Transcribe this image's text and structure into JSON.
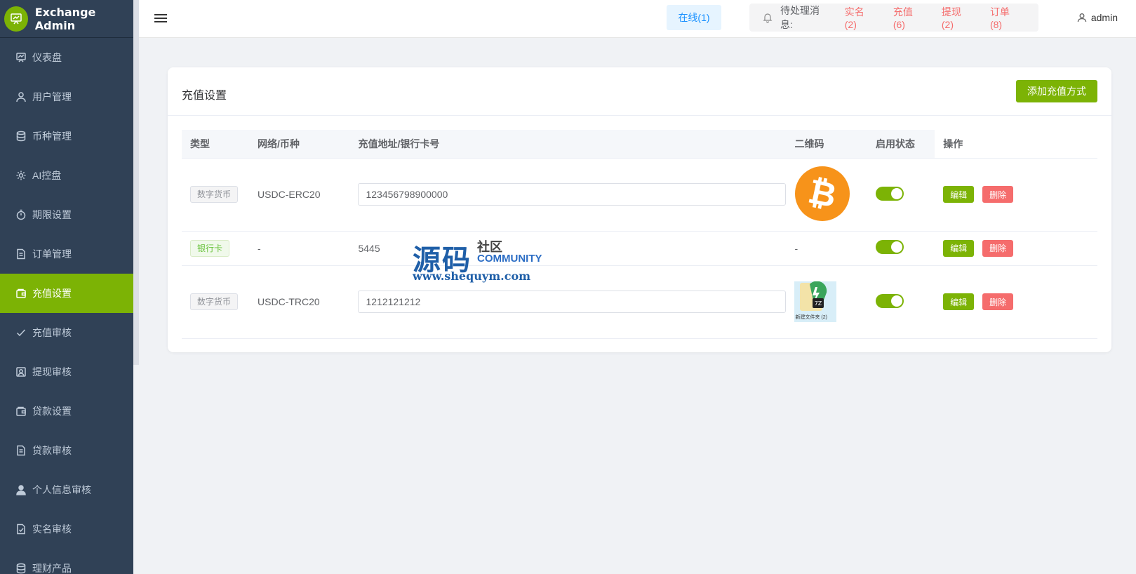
{
  "app": {
    "title": "Exchange Admin"
  },
  "sidebar": {
    "items": [
      {
        "label": "仪表盘",
        "icon": "dashboard-icon"
      },
      {
        "label": "用户管理",
        "icon": "user-icon"
      },
      {
        "label": "币种管理",
        "icon": "database-icon"
      },
      {
        "label": "AI控盘",
        "icon": "gear-icon"
      },
      {
        "label": "期限设置",
        "icon": "stopwatch-icon"
      },
      {
        "label": "订单管理",
        "icon": "document-icon"
      },
      {
        "label": "充值设置",
        "icon": "wallet-icon",
        "active": true
      },
      {
        "label": "充值审核",
        "icon": "check-icon"
      },
      {
        "label": "提现审核",
        "icon": "image-icon"
      },
      {
        "label": "贷款设置",
        "icon": "wallet-icon"
      },
      {
        "label": "贷款审核",
        "icon": "document-icon"
      },
      {
        "label": "个人信息审核",
        "icon": "person-filled-icon"
      },
      {
        "label": "实名审核",
        "icon": "doc-check-icon"
      },
      {
        "label": "理财产品",
        "icon": "database-icon"
      }
    ]
  },
  "header": {
    "online": "在线(1)",
    "pending_label": "待处理消息:",
    "pending_links": [
      "实名(2)",
      "充值(6)",
      "提现(2)",
      "订单(8)"
    ],
    "user": "admin"
  },
  "card": {
    "title": "充值设置",
    "add_button": "添加充值方式"
  },
  "table": {
    "headers": [
      "类型",
      "网络/币种",
      "充值地址/银行卡号",
      "二维码",
      "启用状态",
      "操作"
    ],
    "rows": [
      {
        "type": "数字货币",
        "type_style": "gray",
        "network": "USDC-ERC20",
        "address": "123456798900000",
        "address_input": true,
        "qr": "bitcoin",
        "enabled": true
      },
      {
        "type": "银行卡",
        "type_style": "green",
        "network": "-",
        "address": "5445",
        "address_input": false,
        "qr": "-",
        "enabled": true
      },
      {
        "type": "数字货币",
        "type_style": "gray",
        "network": "USDC-TRC20",
        "address": "1212121212",
        "address_input": true,
        "qr": "file",
        "qr_caption": "新建文件夹 (2)",
        "enabled": true
      }
    ],
    "edit_label": "编辑",
    "delete_label": "删除"
  },
  "watermark": {
    "main": "源码",
    "cn": "社区",
    "en": "COMMUNITY",
    "url": "www.shequym.com"
  },
  "colors": {
    "sidebar_bg": "#304156",
    "accent": "#7cb305",
    "danger": "#f56c6c",
    "online_text": "#1890ff"
  }
}
